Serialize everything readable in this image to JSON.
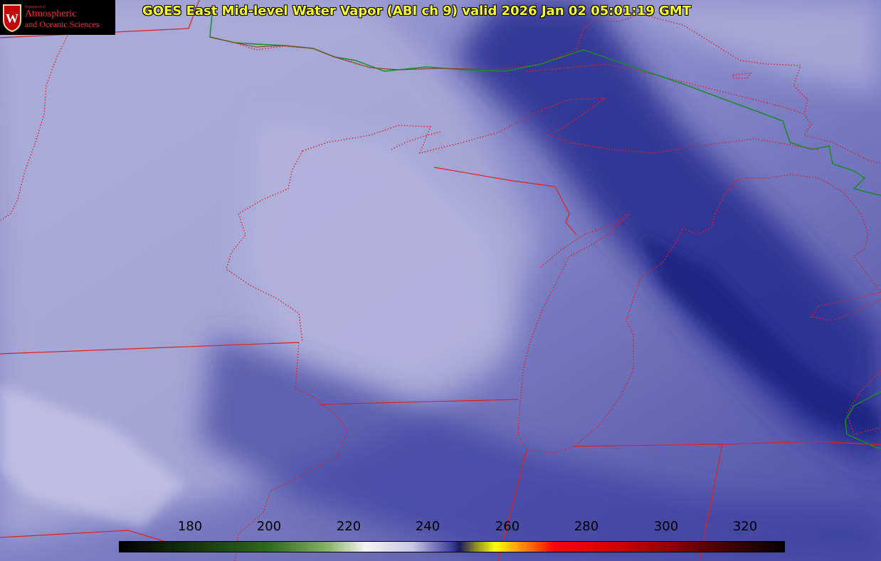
{
  "title": "GOES East Mid-level Water Vapor (ABI ch 9)  valid 2026 Jan 02 05:01:19 GMT",
  "logo": {
    "dept": "Department of",
    "line1": "Atmospheric",
    "line2": "and Oceanic Sciences",
    "crest_letter": "W"
  },
  "colorbar": {
    "ticks": [
      "180",
      "200",
      "220",
      "240",
      "260",
      "280",
      "300",
      "320"
    ],
    "min_value": 162,
    "max_value": 330,
    "stops": [
      {
        "value": 162,
        "color": "#000000"
      },
      {
        "value": 200,
        "color": "#2e6a1e"
      },
      {
        "value": 215,
        "color": "#8ab46a"
      },
      {
        "value": 224,
        "color": "#f4f4f4"
      },
      {
        "value": 236,
        "color": "#c8c8e6"
      },
      {
        "value": 246,
        "color": "#3c3c9a"
      },
      {
        "value": 248,
        "color": "#1a1a5e"
      },
      {
        "value": 252,
        "color": "#8a8a2a"
      },
      {
        "value": 257,
        "color": "#ffff00"
      },
      {
        "value": 264,
        "color": "#ff8a00"
      },
      {
        "value": 272,
        "color": "#ff0000"
      },
      {
        "value": 290,
        "color": "#c80000"
      },
      {
        "value": 310,
        "color": "#5a0000"
      },
      {
        "value": 330,
        "color": "#050000"
      }
    ]
  },
  "colors": {
    "state_border": "#e02020",
    "country_border": "#1a8a2a",
    "title_text": "#ffff2a",
    "imagery_base": "#5a5cae",
    "dry_slot": "#23288a",
    "moist_band": "#b4b6dc"
  }
}
